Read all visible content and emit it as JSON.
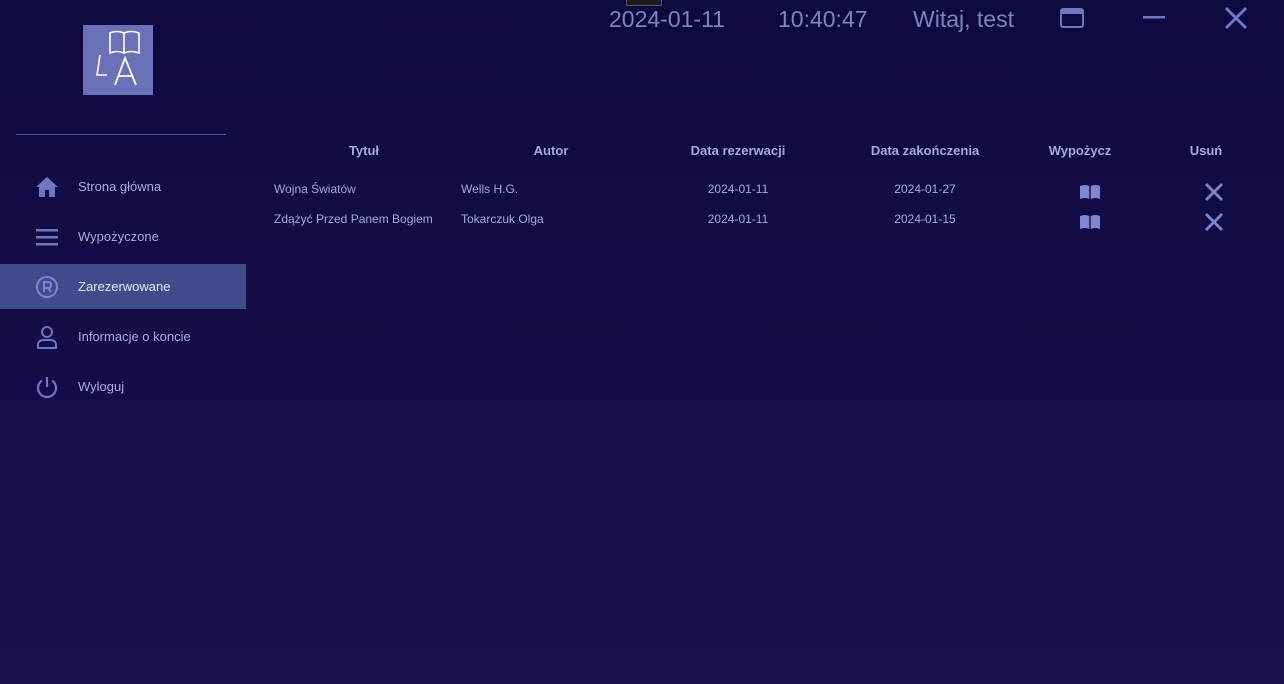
{
  "header": {
    "date": "2024-01-11",
    "time": "10:40:47",
    "greeting": "Witaj, test"
  },
  "logo": {
    "text": "LA"
  },
  "sidebar": {
    "items": [
      {
        "label": "Strona główna",
        "icon": "home-icon"
      },
      {
        "label": "Wypożyczone",
        "icon": "menu-icon"
      },
      {
        "label": "Zarezerwowane",
        "icon": "registered-icon",
        "active": true
      },
      {
        "label": "Informacje o koncie",
        "icon": "user-icon"
      },
      {
        "label": "Wyloguj",
        "icon": "power-icon"
      }
    ]
  },
  "table": {
    "columns": [
      "Tytuł",
      "Autor",
      "Data rezerwacji",
      "Data zakończenia",
      "Wypożycz",
      "Usuń"
    ],
    "rows": [
      {
        "title": "Wojna Światów",
        "author": "Wells H.G.",
        "reserved": "2024-01-11",
        "end": "2024-01-27"
      },
      {
        "title": "Zdążyć Przed Panem Bogiem",
        "author": "Tokarczuk Olga",
        "reserved": "2024-01-11",
        "end": "2024-01-15"
      }
    ]
  },
  "colors": {
    "background": "#140c48",
    "accent": "#6b71b8",
    "active_item": "#414b8c",
    "icon": "#6f77c4"
  }
}
